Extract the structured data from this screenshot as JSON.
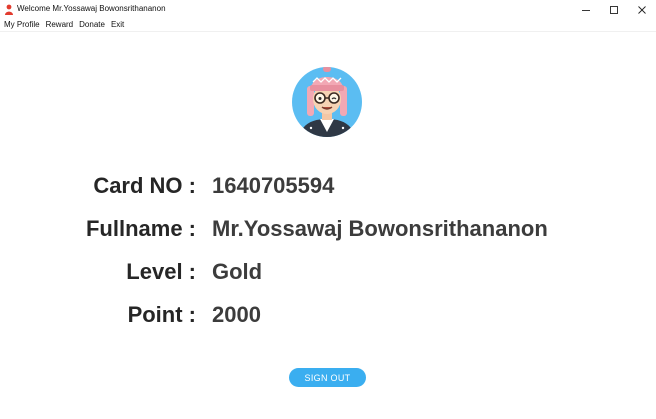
{
  "window": {
    "title": "Welcome Mr.Yossawaj Bowonsrithananon",
    "controls": {
      "minimize": "minimize",
      "maximize": "maximize",
      "close": "close"
    }
  },
  "menu": {
    "items": [
      "My Profile",
      "Reward",
      "Donate",
      "Exit"
    ]
  },
  "profile": {
    "avatar_icon": "cartoon-avatar-icon",
    "rows": [
      {
        "label": "Card NO :",
        "value": "1640705594"
      },
      {
        "label": "Fullname :",
        "value": "Mr.Yossawaj Bowonsrithananon"
      },
      {
        "label": "Level :",
        "value": "Gold"
      },
      {
        "label": "Point :",
        "value": "2000"
      }
    ]
  },
  "signout": {
    "label": "SIGN OUT",
    "color": "#3aaef0"
  }
}
